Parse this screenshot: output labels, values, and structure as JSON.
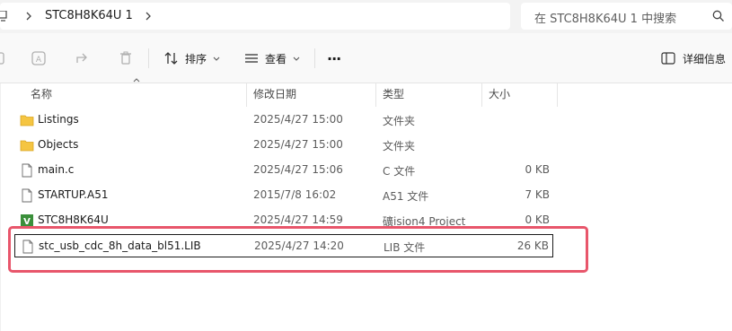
{
  "addressbar": {
    "crumb": "STC8H8K64U 1",
    "search_placeholder": "在 STC8H8K64U 1 中搜索"
  },
  "toolbar": {
    "sort_label": "排序",
    "view_label": "查看",
    "more_label": "···",
    "details_label": "详细信息"
  },
  "columns": {
    "name": "名称",
    "date": "修改日期",
    "type": "类型",
    "size": "大小"
  },
  "files": [
    {
      "name": "Listings",
      "date": "2025/4/27 15:00",
      "type": "文件夹",
      "size": "",
      "icon": "folder-icon"
    },
    {
      "name": "Objects",
      "date": "2025/4/27 15:00",
      "type": "文件夹",
      "size": "",
      "icon": "folder-icon"
    },
    {
      "name": "main.c",
      "date": "2025/4/27 15:06",
      "type": "C 文件",
      "size": "0 KB",
      "icon": "file-icon"
    },
    {
      "name": "STARTUP.A51",
      "date": "2015/7/8 16:02",
      "type": "A51 文件",
      "size": "7 KB",
      "icon": "file-icon"
    },
    {
      "name": "STC8H8K64U",
      "date": "2025/4/27 14:59",
      "type": "礦ision4 Project",
      "size": "0 KB",
      "icon": "keil-project-icon"
    },
    {
      "name": "stc_usb_cdc_8h_data_bl51.LIB",
      "date": "2025/4/27 14:20",
      "type": "LIB 文件",
      "size": "26 KB",
      "icon": "file-icon",
      "selected": true
    }
  ],
  "colors": {
    "highlight": "#e8566b",
    "folder": "#f5c542",
    "keil": "#3a8f3a"
  }
}
